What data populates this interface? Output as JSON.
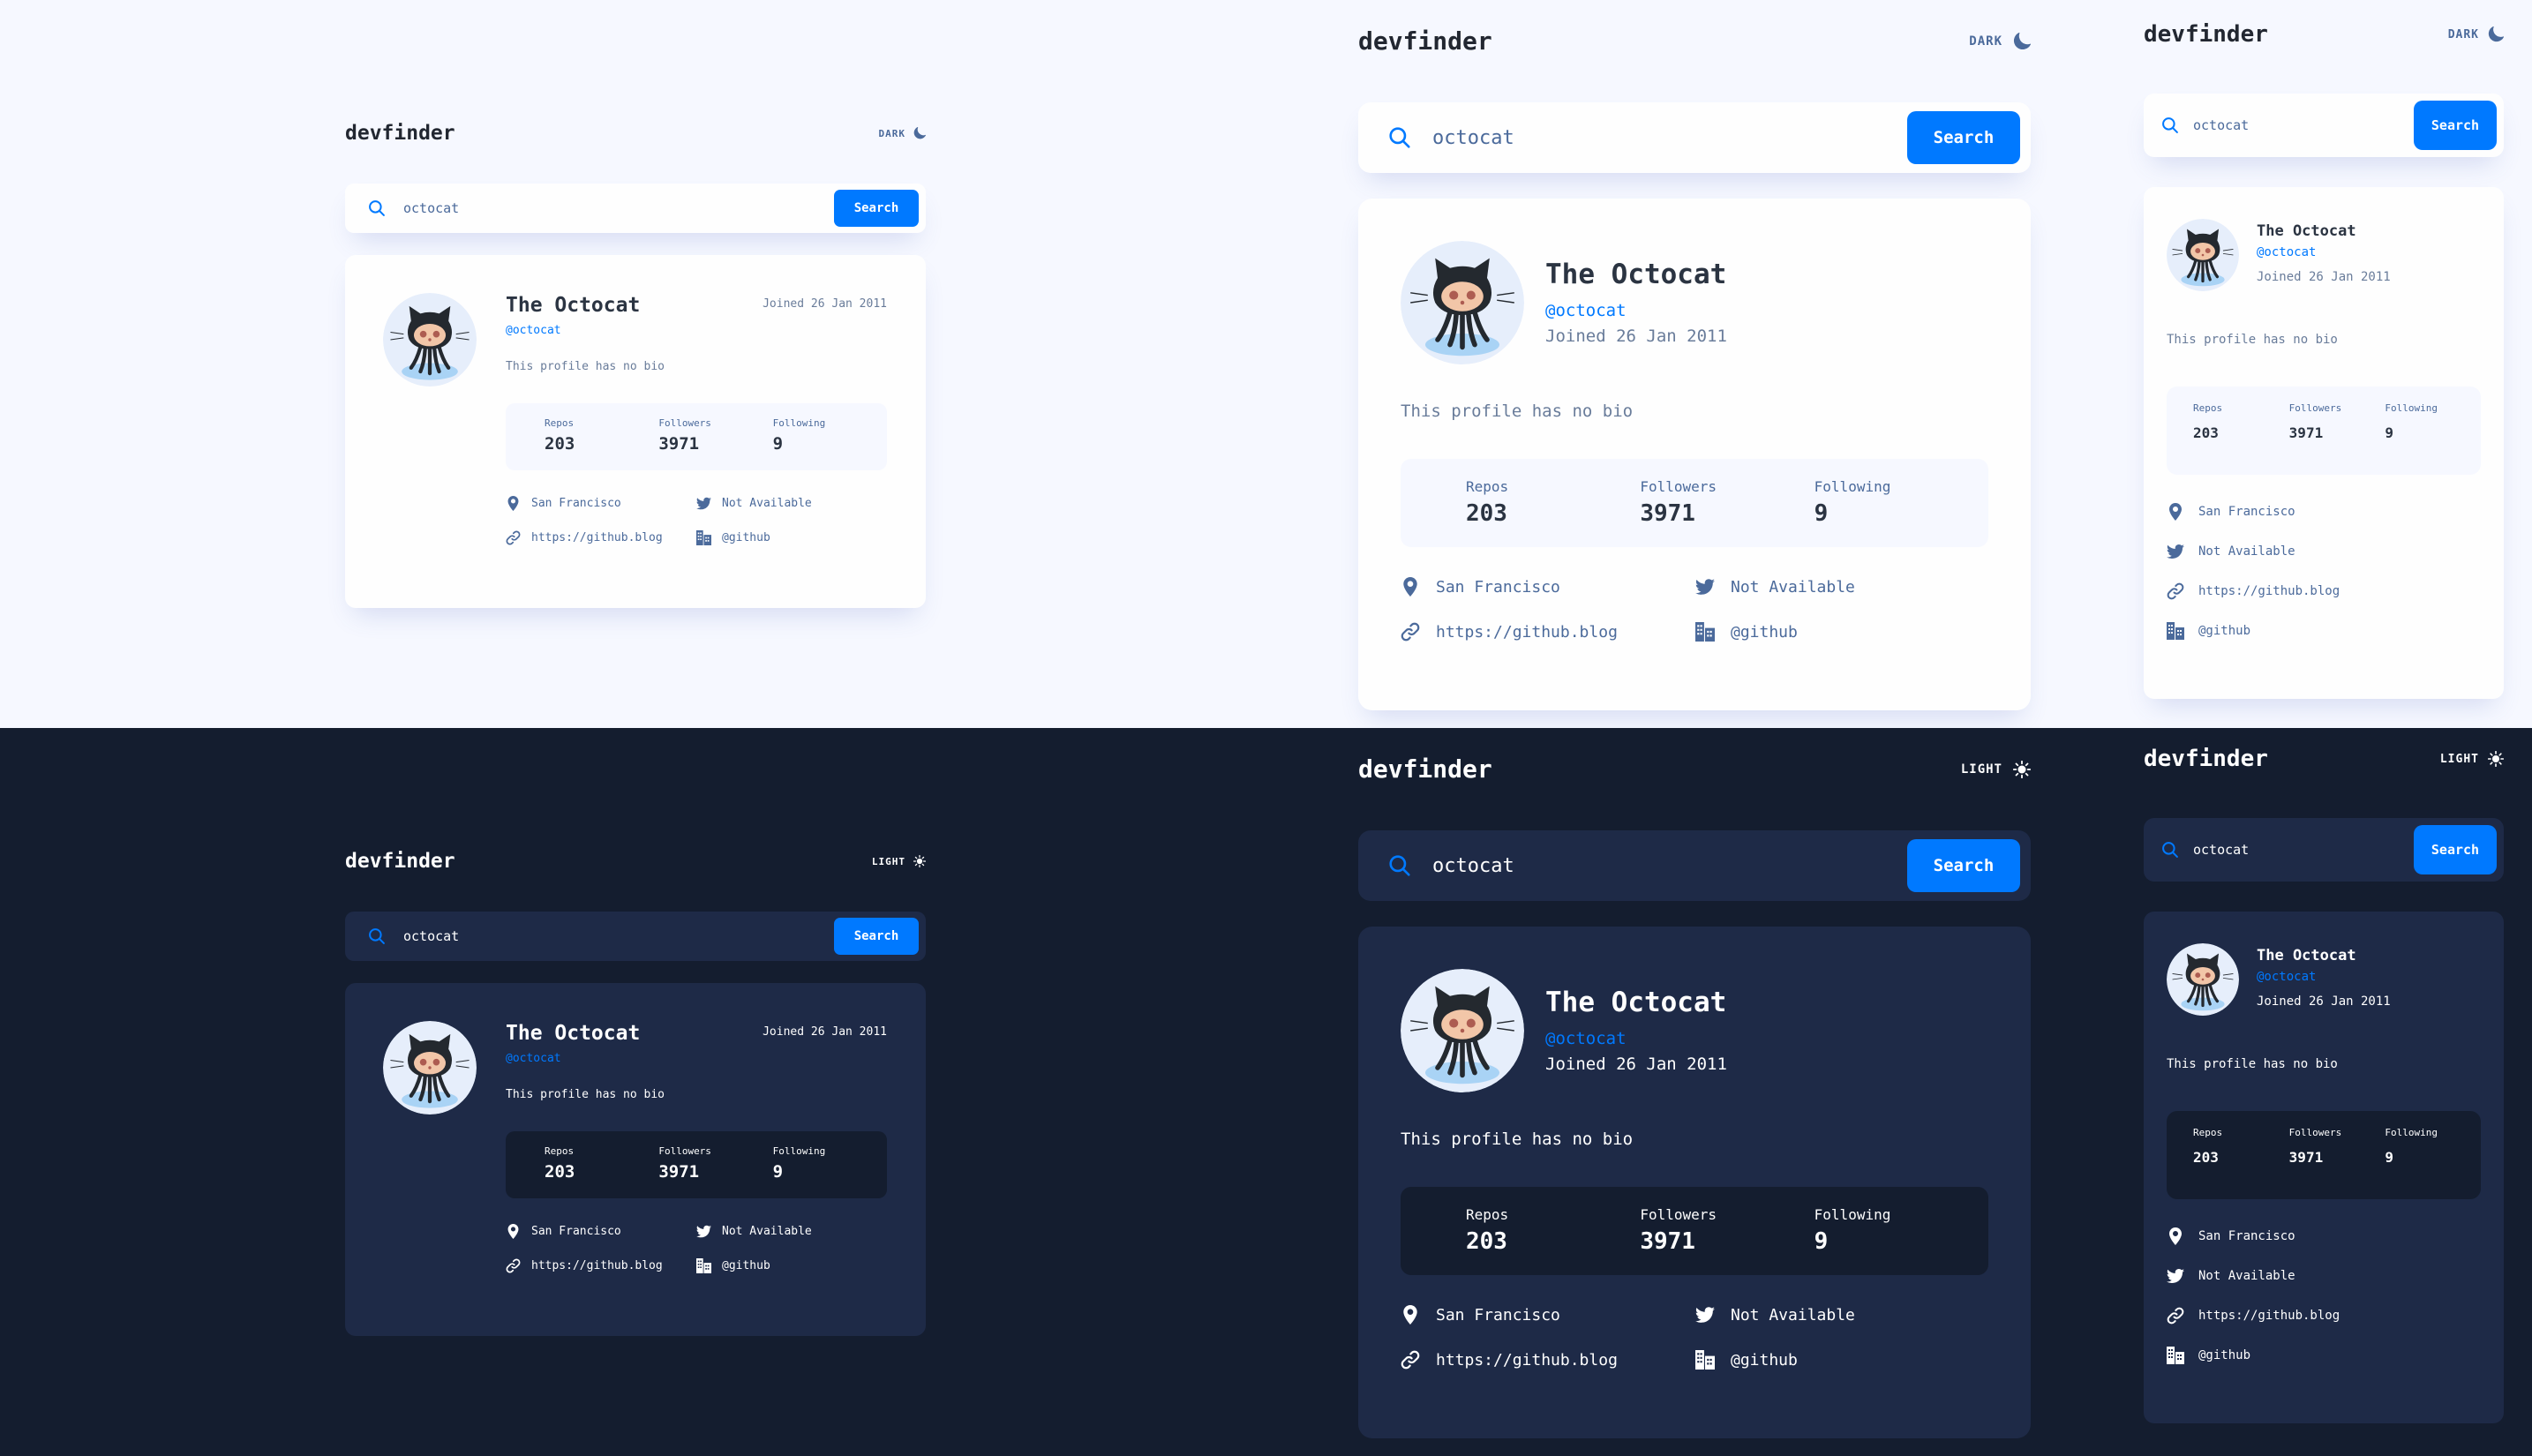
{
  "app": {
    "logo": "devfinder",
    "theme_toggle_light": "DARK",
    "theme_toggle_dark": "LIGHT"
  },
  "search": {
    "value": "octocat",
    "button_label": "Search"
  },
  "profile": {
    "name": "The Octocat",
    "login": "@octocat",
    "joined": "Joined 26 Jan 2011",
    "bio": "This profile has no bio"
  },
  "stats": {
    "repos_label": "Repos",
    "repos_value": "203",
    "followers_label": "Followers",
    "followers_value": "3971",
    "following_label": "Following",
    "following_value": "9"
  },
  "links": {
    "location": "San Francisco",
    "twitter": "Not Available",
    "blog": "https://github.blog",
    "company": "@github"
  },
  "colors": {
    "accent": "#0079ff",
    "light_bg": "#f6f8ff",
    "light_card": "#fefefe",
    "dark_bg": "#141d2f",
    "dark_card": "#1e2a47"
  },
  "icons": {
    "theme_light": "moon-icon",
    "theme_dark": "sun-icon",
    "search": "search-icon",
    "location": "location-pin-icon",
    "twitter": "twitter-icon",
    "blog": "link-icon",
    "company": "office-building-icon"
  }
}
